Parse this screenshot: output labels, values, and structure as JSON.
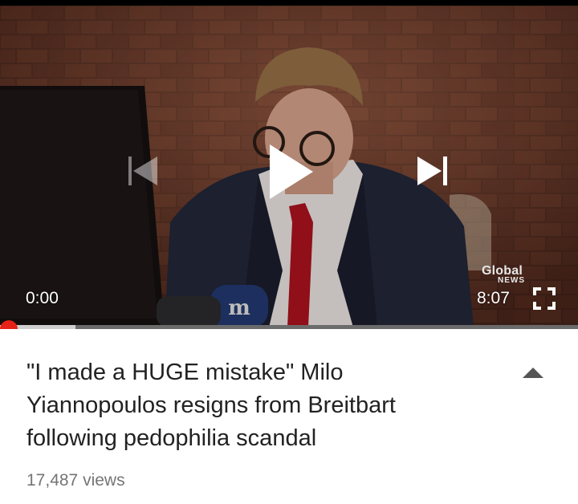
{
  "player": {
    "current_time": "0:00",
    "duration": "8:07",
    "progress_fraction": 0.0,
    "buffer_fraction": 0.13,
    "watermark_logo": "Global NEWS",
    "mic_logo": "m",
    "icons": [
      "previous-icon",
      "play-icon",
      "next-icon",
      "fullscreen-icon"
    ]
  },
  "video": {
    "title": "\"I made a HUGE mistake\" Milo Yiannopoulos resigns from Breitbart following pedophilia scandal",
    "views": "17,487 views"
  },
  "colors": {
    "progress_played": "#e62117",
    "progress_buffer": "#cfcfcf",
    "progress_track": "#6b6b6b",
    "title_text": "#222222",
    "secondary_text": "#757575"
  }
}
